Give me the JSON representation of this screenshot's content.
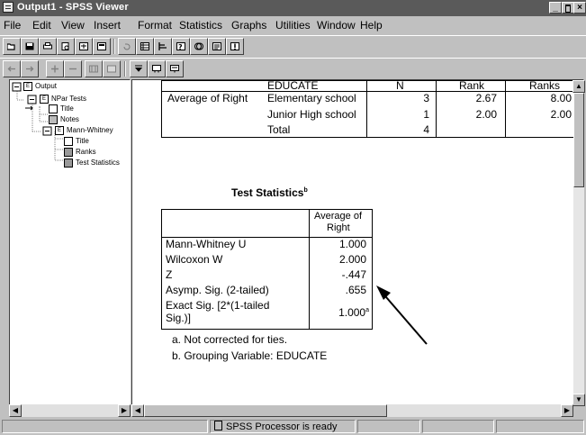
{
  "window": {
    "title": "Output1 - SPSS Viewer",
    "controls": [
      "_",
      "×"
    ]
  },
  "menu": [
    {
      "label": "File"
    },
    {
      "label": "Edit"
    },
    {
      "label": "View"
    },
    {
      "label": "Insert"
    },
    {
      "label": "Format"
    },
    {
      "label": "Statistics"
    },
    {
      "label": "Graphs"
    },
    {
      "label": "Utilities"
    },
    {
      "label": "Window"
    },
    {
      "label": "Help"
    }
  ],
  "tree": {
    "root": "Output",
    "npar": "NPar Tests",
    "title1": "Title",
    "notes": "Notes",
    "mann": "Mann-Whitney",
    "title2": "Title",
    "ranks": "Ranks",
    "teststat": "Test Statistics"
  },
  "ranks_table": {
    "headers": [
      "EDUCATE",
      "N",
      "Rank",
      "Ranks"
    ],
    "row_label": "Average of Right",
    "rows": [
      {
        "group": "Elementary school",
        "n": "3",
        "mean_rank": "2.67",
        "sum_ranks": "8.00"
      },
      {
        "group": "Junior High school",
        "n": "1",
        "mean_rank": "2.00",
        "sum_ranks": "2.00"
      },
      {
        "group": "Total",
        "n": "4",
        "mean_rank": "",
        "sum_ranks": ""
      }
    ]
  },
  "test_stats": {
    "title": "Test Statistics",
    "title_sup": "b",
    "column_header_line1": "Average of",
    "column_header_line2": "Right",
    "rows": [
      {
        "label": "Mann-Whitney U",
        "value": "1.000"
      },
      {
        "label": "Wilcoxon W",
        "value": "2.000"
      },
      {
        "label": "Z",
        "value": "-.447"
      },
      {
        "label": "Asymp. Sig. (2-tailed)",
        "value": ".655"
      },
      {
        "label_line1": "Exact Sig. [2*(1-tailed",
        "label_line2": "Sig.)]",
        "value": "1.000",
        "value_sup": "a"
      }
    ],
    "footnotes": [
      "a. Not corrected for ties.",
      "b. Grouping Variable: EDUCATE"
    ]
  },
  "status": {
    "text": "SPSS Processor is ready"
  }
}
